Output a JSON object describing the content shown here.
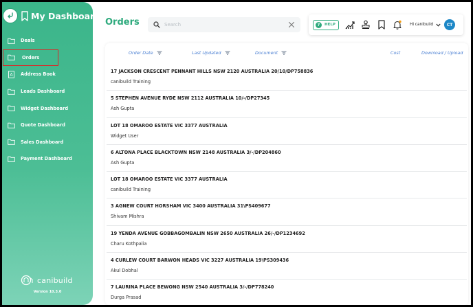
{
  "app": {
    "title": "My Dashboard",
    "brand": "canibuild",
    "version": "Version 10.3.0"
  },
  "sidebar": {
    "items": [
      {
        "label": "Deals",
        "icon": "folder-icon",
        "active": false
      },
      {
        "label": "Orders",
        "icon": "folder-icon",
        "active": true
      },
      {
        "label": "Address Book",
        "icon": "address-book-icon",
        "active": false
      },
      {
        "label": "Leads Dashboard",
        "icon": "folder-icon",
        "active": false
      },
      {
        "label": "Widget Dashboard",
        "icon": "folder-icon",
        "active": false
      },
      {
        "label": "Quote Dashboard",
        "icon": "folder-icon",
        "active": false
      },
      {
        "label": "Sales Dashboard",
        "icon": "folder-icon",
        "active": false
      },
      {
        "label": "Payment Dashboard",
        "icon": "folder-icon",
        "active": false
      }
    ]
  },
  "header": {
    "page_title": "Orders",
    "search_placeholder": "Search",
    "help_label": "HELP",
    "user_greeting": "Hi canibuild",
    "avatar_initials": "CT"
  },
  "table": {
    "columns": {
      "order_date": "Order Date",
      "last_updated": "Last Updated",
      "document": "Document",
      "cost": "Cost",
      "download": "Download / Upload"
    },
    "rows": [
      {
        "address": "17 JACKSON CRESCENT PENNANT HILLS NSW 2120 AUSTRALIA 20/10/DP758836",
        "user": "canibuild Training"
      },
      {
        "address": "5 STEPHEN AVENUE RYDE NSW 2112 AUSTRALIA 10/-/DP27345",
        "user": "Ash Gupta"
      },
      {
        "address": "LOT 18 OMAROO ESTATE VIC 3377 AUSTRALIA",
        "user": "Widget User"
      },
      {
        "address": "6 ALTONA PLACE BLACKTOWN NSW 2148 AUSTRALIA 3/-/DP204860",
        "user": "Ash Gupta"
      },
      {
        "address": "LOT 18 OMAROO ESTATE VIC 3377 AUSTRALIA",
        "user": "canibuild Training"
      },
      {
        "address": "3 AGNEW COURT HORSHAM VIC 3400 AUSTRALIA 31\\PS409677",
        "user": "Shivam Mishra"
      },
      {
        "address": "19 YENDA AVENUE GOBBAGOMBALIN NSW 2650 AUSTRALIA 26/-/DP1234692",
        "user": "Charu Kothpalia"
      },
      {
        "address": "4 CURLEW COURT BARWON HEADS VIC 3227 AUSTRALIA 19\\PS309436",
        "user": "Akul Dobhal"
      },
      {
        "address": "7 LAURINA PLACE BEWONG NSW 2540 AUSTRALIA 3/-/DP778240",
        "user": "Durga Prasad"
      }
    ]
  },
  "colors": {
    "brand_green": "#2eaa7d",
    "active_outline": "#e02424",
    "avatar_blue": "#1e88c7",
    "header_link": "#4a7fd2"
  }
}
